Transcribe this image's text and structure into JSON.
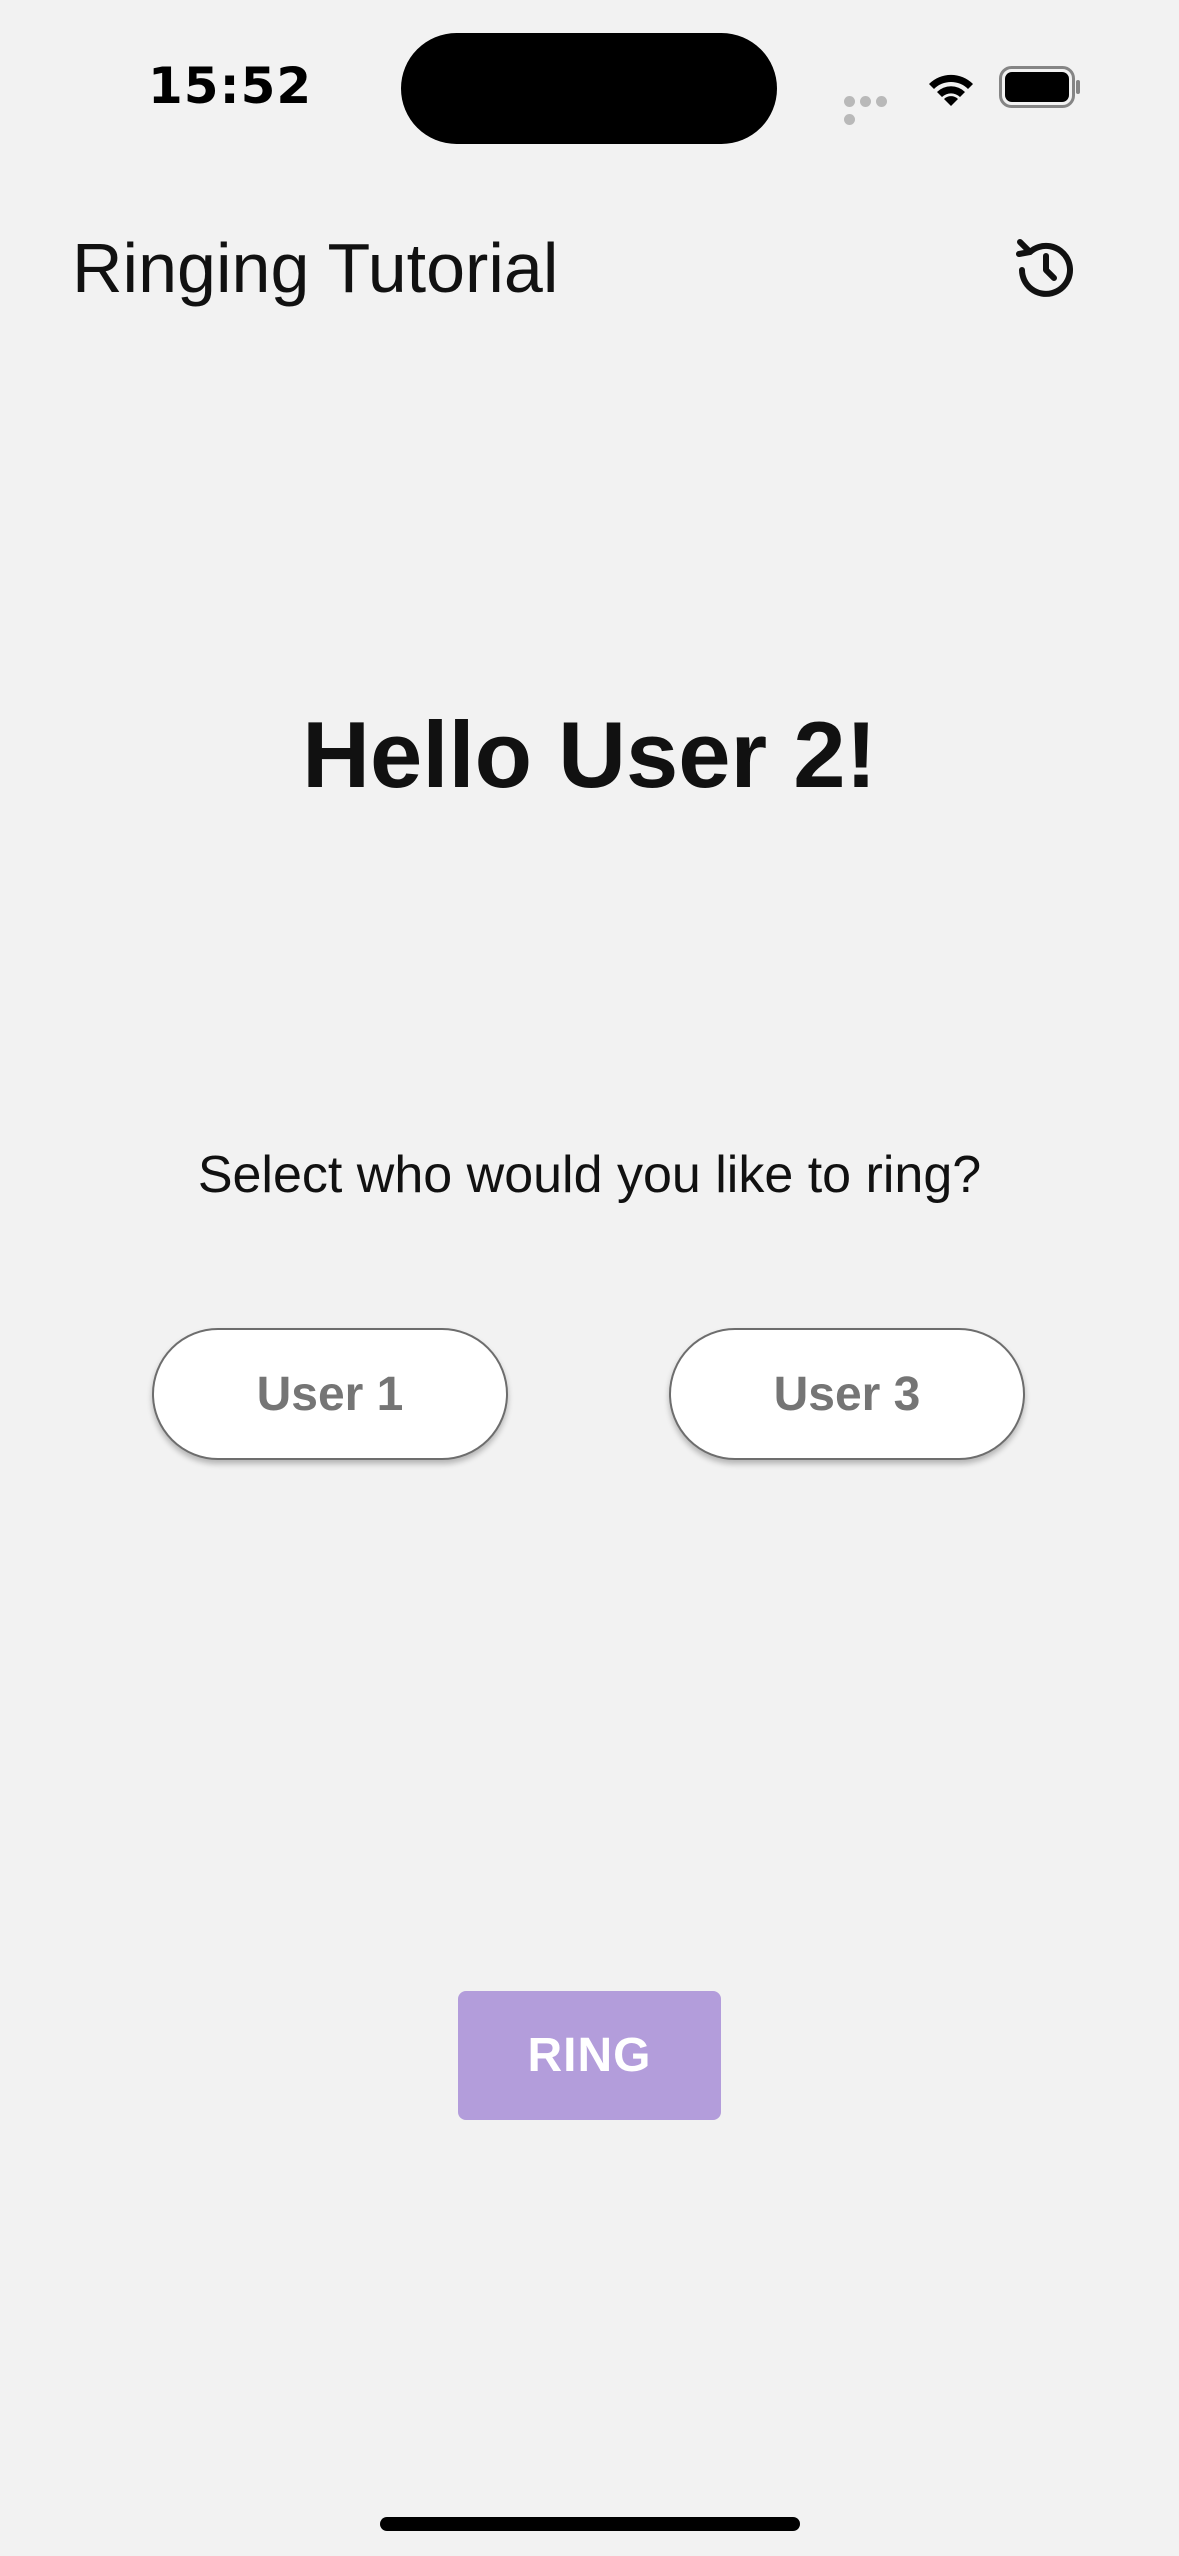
{
  "status_bar": {
    "time": "15:52"
  },
  "header": {
    "title": "Ringing Tutorial",
    "refresh_icon": "refresh-icon"
  },
  "main": {
    "greeting": "Hello User 2!",
    "prompt": "Select who would you like to ring?",
    "users": [
      {
        "label": "User 1"
      },
      {
        "label": "User 3"
      }
    ],
    "ring_label": "RING"
  },
  "colors": {
    "background": "#f2f2f2",
    "ring_button": "#b39ddb",
    "user_button_text": "#757575"
  }
}
